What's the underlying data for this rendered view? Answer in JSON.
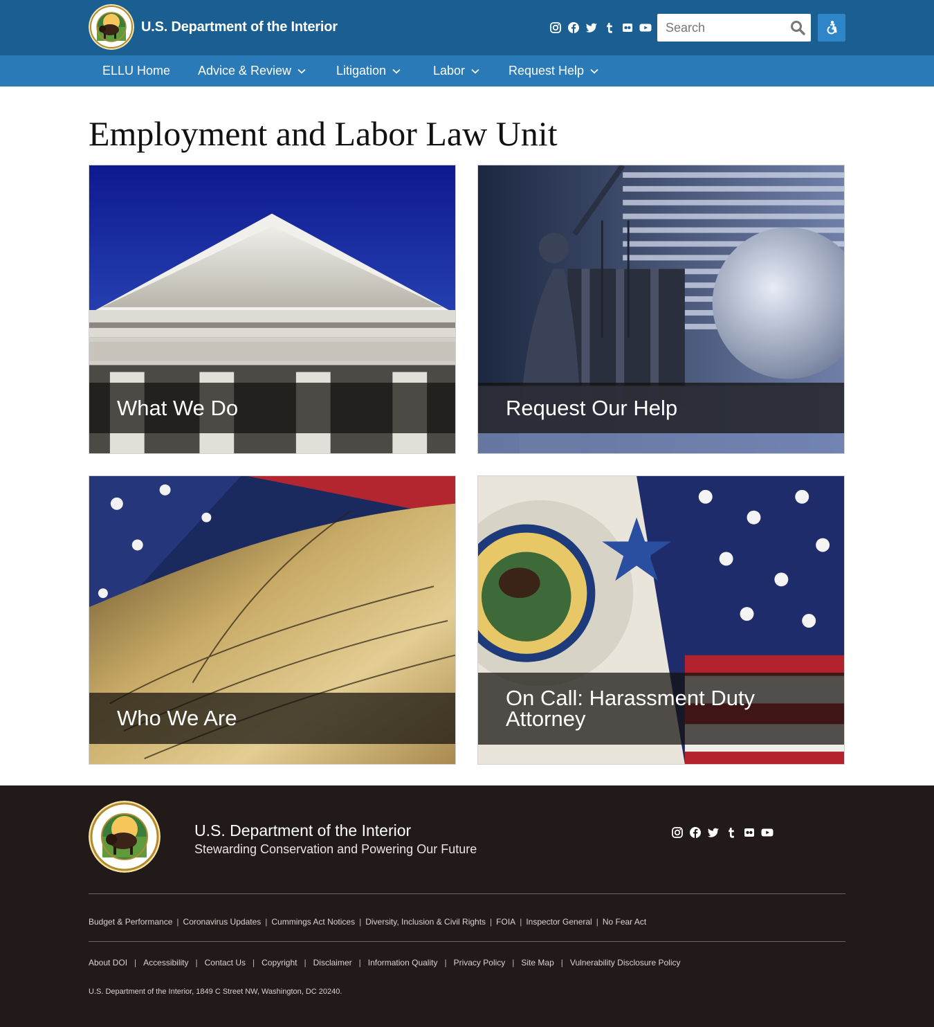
{
  "header": {
    "brand": "U.S. Department of the Interior",
    "search": {
      "placeholder": "Search"
    },
    "social_icons": [
      "instagram-icon",
      "facebook-icon",
      "twitter-icon",
      "tumblr-icon",
      "flickr-icon",
      "youtube-icon"
    ],
    "accessibility_icon": "accessibility-icon",
    "colors": {
      "topbar": "#1b5f92",
      "navbar": "#2a7ab8",
      "access_button": "#2e86c8"
    }
  },
  "nav": {
    "items": [
      {
        "label": "ELLU Home",
        "has_dropdown": false
      },
      {
        "label": "Advice & Review",
        "has_dropdown": true
      },
      {
        "label": "Litigation",
        "has_dropdown": true
      },
      {
        "label": "Labor",
        "has_dropdown": true
      },
      {
        "label": "Request Help",
        "has_dropdown": true
      }
    ]
  },
  "main": {
    "title": "Employment and Labor Law Unit",
    "cards": [
      {
        "label": "What We Do"
      },
      {
        "label": "Request Our Help"
      },
      {
        "label": "Who We Are"
      },
      {
        "label": "On Call: Harassment Duty Attorney"
      }
    ]
  },
  "footer": {
    "title": "U.S. Department of the Interior",
    "tagline": "Stewarding Conservation and Powering Our Future",
    "links_row1": [
      "Budget & Performance",
      "Coronavirus Updates",
      "Cummings Act Notices",
      "Diversity, Inclusion & Civil Rights",
      "FOIA",
      "Inspector General",
      "No Fear Act"
    ],
    "links_row2": [
      "About DOI",
      "Accessibility",
      "Contact Us",
      "Copyright",
      "Disclaimer",
      "Information Quality",
      "Privacy Policy",
      "Site Map",
      "Vulnerability Disclosure Policy"
    ],
    "address": "U.S. Department of the Interior, 1849 C Street NW, Washington, DC 20240.",
    "colors": {
      "background": "#221a18"
    }
  }
}
